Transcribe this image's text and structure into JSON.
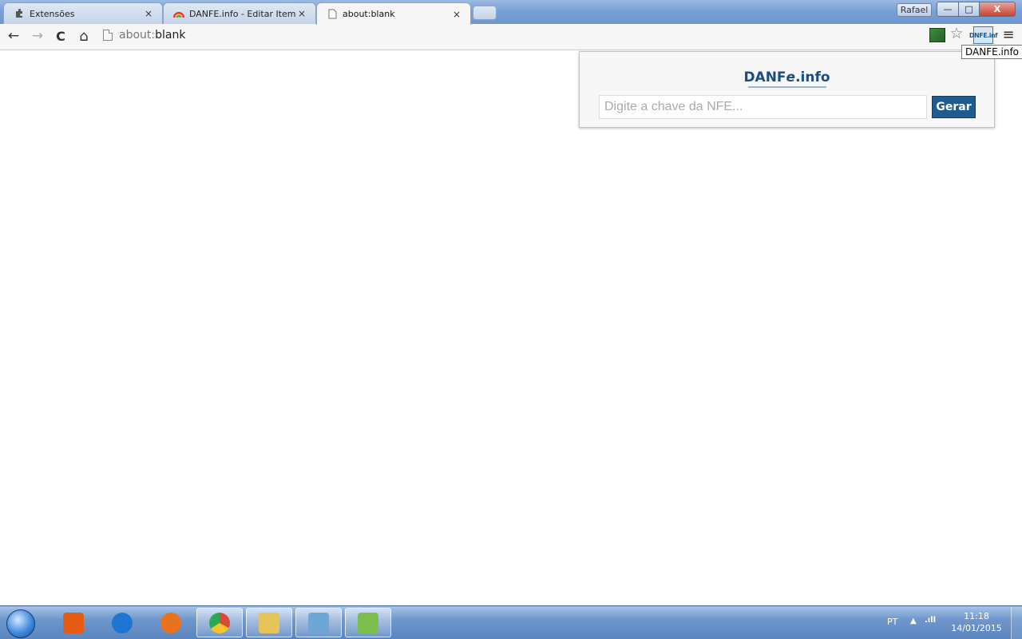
{
  "tabs": [
    {
      "title": "Extensões",
      "icon": "puzzle-icon",
      "close": "×",
      "active": false
    },
    {
      "title": "DANFE.info - Editar Item",
      "icon": "rainbow-icon",
      "close": "×",
      "active": false
    },
    {
      "title": "about:blank",
      "icon": "page-icon",
      "close": "×",
      "active": true
    }
  ],
  "window": {
    "profile_name": "Rafael",
    "minimize": "—",
    "maximize": "□",
    "close": "X"
  },
  "toolbar": {
    "back": "←",
    "forward": "→",
    "reload": "C",
    "home": "⌂",
    "url_scheme": "about:",
    "url_rest": "blank",
    "star": "☆",
    "extension_label": "DNFE.inf",
    "menu": "≡"
  },
  "tooltip": "DANFE.info",
  "popup": {
    "logo_a": "DANF",
    "logo_e": "e",
    "logo_b": ".info",
    "input_placeholder": "Digite a chave da NFE...",
    "button_label": "Gerar"
  },
  "taskbar": {
    "apps": [
      {
        "name": "media-player-icon",
        "color": "#e65c12"
      },
      {
        "name": "internet-explorer-icon",
        "color": "#1f76d2"
      },
      {
        "name": "firefox-icon",
        "color": "#e8731c"
      },
      {
        "name": "chrome-icon",
        "color": "#d84a38"
      },
      {
        "name": "file-explorer-icon",
        "color": "#e6c45a"
      },
      {
        "name": "notepad-icon",
        "color": "#6ea6d8"
      },
      {
        "name": "notepadpp-icon",
        "color": "#7cbf4e"
      }
    ],
    "language": "PT",
    "tray_arrow": "▲",
    "signal": ".ıll",
    "time": "11:18",
    "date": "14/01/2015"
  }
}
